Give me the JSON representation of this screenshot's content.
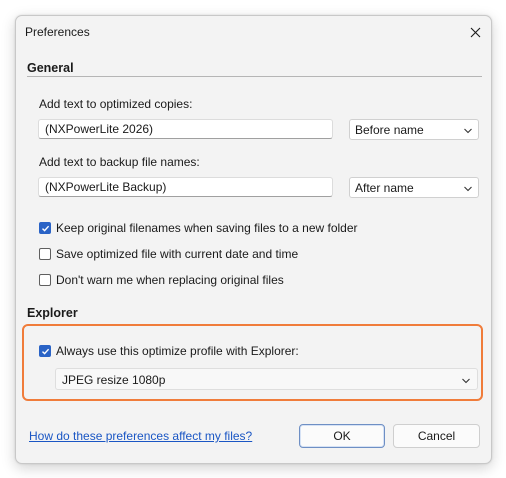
{
  "window": {
    "title": "Preferences"
  },
  "general": {
    "heading": "General",
    "optimized": {
      "label": "Add text to optimized copies:",
      "value": "(NXPowerLite 2026)",
      "position": "Before name"
    },
    "backup": {
      "label": "Add text to backup file names:",
      "value": "(NXPowerLite Backup)",
      "position": "After name"
    },
    "options": [
      {
        "label": "Keep original filenames when saving files to a new folder",
        "checked": true
      },
      {
        "label": "Save optimized file with current date and time",
        "checked": false
      },
      {
        "label": "Don't warn me when replacing original files",
        "checked": false
      }
    ]
  },
  "explorer": {
    "heading": "Explorer",
    "always_use": {
      "label": "Always use this optimize profile with Explorer:",
      "checked": true
    },
    "profile": "JPEG resize 1080p"
  },
  "footer": {
    "help_link": "How do these preferences affect my files?",
    "ok_label": "OK",
    "cancel_label": "Cancel"
  },
  "colors": {
    "accent": "#2a63c6",
    "highlight": "#f07c3a",
    "link": "#1a56c4"
  }
}
